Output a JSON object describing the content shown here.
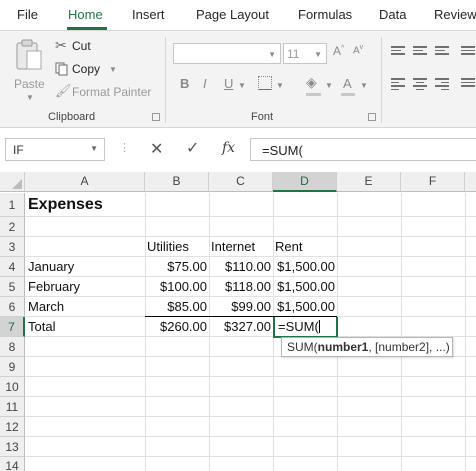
{
  "tabs": [
    "File",
    "Home",
    "Insert",
    "Page Layout",
    "Formulas",
    "Data",
    "Review"
  ],
  "active_tab": "Home",
  "accent": "#217346",
  "clipboard": {
    "paste": "Paste",
    "cut": "Cut",
    "copy": "Copy",
    "format_painter": "Format Painter",
    "group_label": "Clipboard"
  },
  "font": {
    "font_name": "",
    "font_size": "11",
    "bold": "B",
    "italic": "I",
    "underline": "U",
    "font_color": "A",
    "group_label": "Font"
  },
  "formula_bar": {
    "name_box": "IF",
    "fx": "fx",
    "formula": "=SUM("
  },
  "columns": [
    "A",
    "B",
    "C",
    "D",
    "E",
    "F"
  ],
  "selected_column": "D",
  "rows": [
    "1",
    "2",
    "3",
    "4",
    "5",
    "6",
    "7",
    "8",
    "9",
    "10",
    "11",
    "12",
    "13",
    "14"
  ],
  "selected_row": "7",
  "sheet": {
    "title": "Expenses",
    "headers": [
      "Utilities",
      "Internet",
      "Rent"
    ],
    "data": [
      {
        "month": "January",
        "utilities": "$75.00",
        "internet": "$110.00",
        "rent": "$1,500.00"
      },
      {
        "month": "February",
        "utilities": "$100.00",
        "internet": "$118.00",
        "rent": "$1,500.00"
      },
      {
        "month": "March",
        "utilities": "$85.00",
        "internet": "$99.00",
        "rent": "$1,500.00"
      }
    ],
    "total": {
      "label": "Total",
      "utilities": "$260.00",
      "internet": "$327.00",
      "rent": "=SUM("
    }
  },
  "tooltip": {
    "fn": "SUM(",
    "arg1": "number1",
    "rest": ", [number2], ...)"
  }
}
